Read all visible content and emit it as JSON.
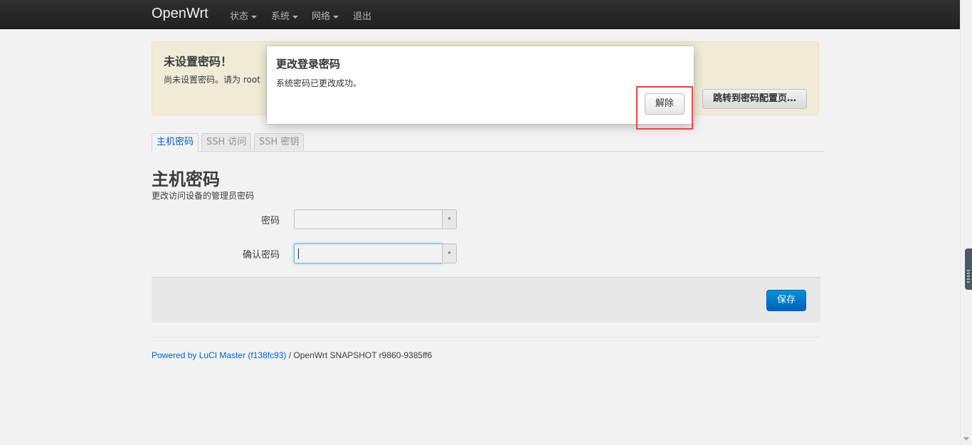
{
  "navbar": {
    "brand": "OpenWrt",
    "menu": [
      {
        "label": "状态",
        "dropdown": true
      },
      {
        "label": "系统",
        "dropdown": true
      },
      {
        "label": "网络",
        "dropdown": true
      },
      {
        "label": "退出",
        "dropdown": false
      }
    ]
  },
  "alert": {
    "title": "未设置密码！",
    "body": "尚未设置密码。请为 root",
    "goto_button": "跳转到密码配置页…"
  },
  "tabs": [
    {
      "label": "主机密码",
      "active": true
    },
    {
      "label": "SSH 访问",
      "active": false
    },
    {
      "label": "SSH 密钥",
      "active": false
    }
  ],
  "section": {
    "title": "主机密码",
    "description": "更改访问设备的管理员密码"
  },
  "fields": [
    {
      "label": "密码",
      "value": "",
      "addon": "*"
    },
    {
      "label": "确认密码",
      "value": "",
      "addon": "*",
      "focused": true
    }
  ],
  "actions": {
    "save_label": "保存"
  },
  "footer": {
    "link_text": "Powered by LuCI Master (f138fc93)",
    "rest_text": " / OpenWrt SNAPSHOT r9860-9385ff6"
  },
  "modal": {
    "title": "更改登录密码",
    "message": "系统密码已更改成功。",
    "dismiss_label": "解除"
  },
  "colors": {
    "navbar_bg": "#222222",
    "alert_bg": "#fcf8e3",
    "primary": "#0064cd",
    "highlight": "#e64545"
  }
}
